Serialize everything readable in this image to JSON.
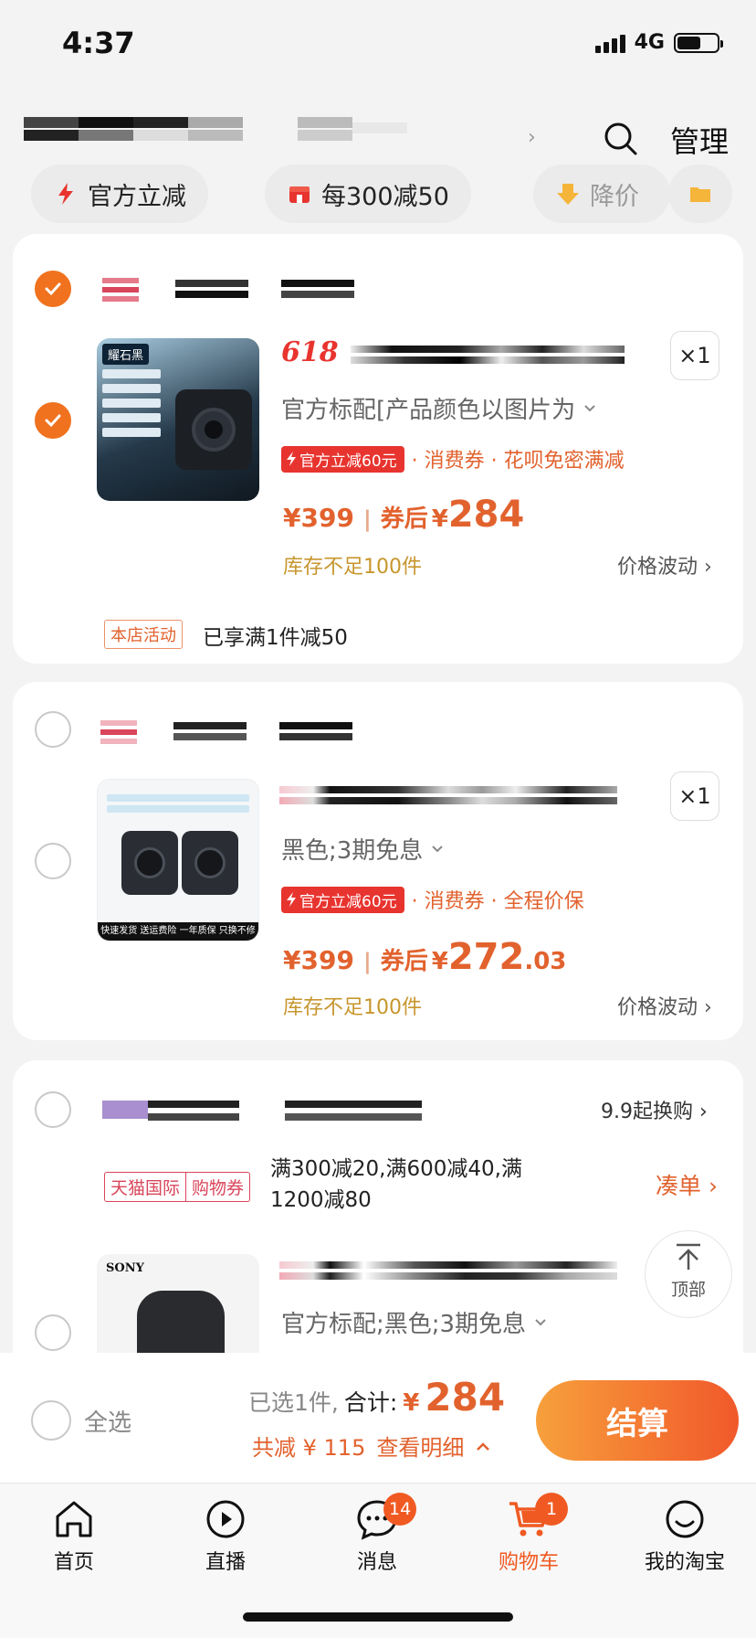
{
  "status": {
    "time": "4:37",
    "network": "4G"
  },
  "header": {
    "manage_label": "管理"
  },
  "pills": [
    {
      "label": "官方立减"
    },
    {
      "label": "每300减50"
    },
    {
      "label": "降价"
    }
  ],
  "cart": [
    {
      "selected": true,
      "brand_tag": "618",
      "quantity": "×1",
      "sku": "官方标配[产品颜色以图片为",
      "tag": "官方立减60元",
      "promo_text": "· 消费券 · 花呗免密满减",
      "price": "¥399",
      "coupon_label": "券后",
      "coupon_currency": "¥",
      "coupon_price": "284",
      "coupon_price_decimal": "",
      "stock": "库存不足100件",
      "wave": "价格波动",
      "thumb_label": "耀石黑",
      "shop_activity_tag": "本店活动",
      "shop_activity_text": "已享满1件减50"
    },
    {
      "selected": false,
      "quantity": "×1",
      "sku": "黑色;3期免息",
      "tag": "官方立减60元",
      "promo_text": "· 消费券 · 全程价保",
      "price": "¥399",
      "coupon_label": "券后",
      "coupon_currency": "¥",
      "coupon_price": "272",
      "coupon_price_decimal": ".03",
      "stock": "库存不足100件",
      "wave": "价格波动",
      "thumb_caption": "快速发货  送运费险  一年质保  只换不修"
    },
    {
      "selected": false,
      "swap_label": "9.9起换购",
      "tag_left": "天猫国际",
      "tag_right": "购物券",
      "coupon_desc_1": "满300减20,满600减40,满",
      "coupon_desc_2": "1200减80",
      "gather_label": "凑单",
      "sku": "官方标配;黑色;3期免息",
      "thumb_brand": "SONY"
    }
  ],
  "to_top_label": "顶部",
  "checkout": {
    "select_all": "全选",
    "selected_count": "已选1件,",
    "total_label": "合计:",
    "currency": "¥",
    "total": "284",
    "discount": "共减 ¥ 115",
    "detail": "查看明细",
    "button": "结算"
  },
  "tabs": [
    {
      "label": "首页",
      "icon": "home-icon"
    },
    {
      "label": "直播",
      "icon": "live-icon"
    },
    {
      "label": "消息",
      "icon": "message-icon",
      "badge": "14"
    },
    {
      "label": "购物车",
      "icon": "cart-icon",
      "badge": "1",
      "active": true
    },
    {
      "label": "我的淘宝",
      "icon": "profile-icon"
    }
  ],
  "colors": {
    "accent": "#f0721e",
    "price": "#e2622e",
    "badge": "#f05a22",
    "stock": "#c7962d"
  }
}
